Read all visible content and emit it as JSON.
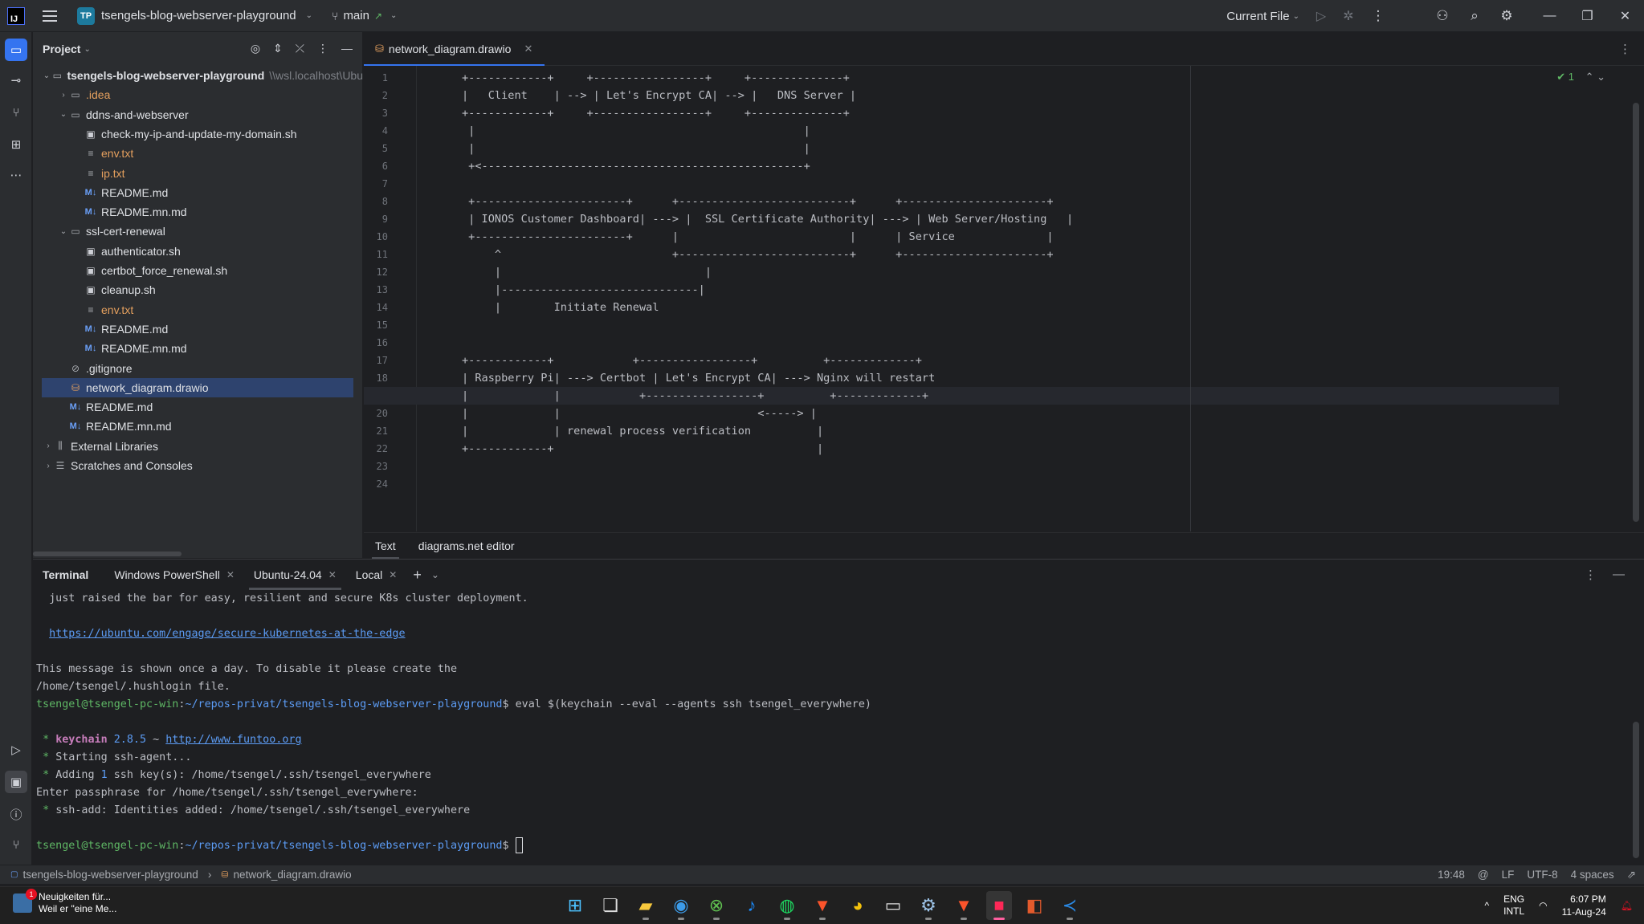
{
  "titlebar": {
    "badge": "TP",
    "project": "tsengels-blog-webserver-playground",
    "branch": "main",
    "branch_arrow": "↗",
    "run_config": "Current File"
  },
  "project_panel": {
    "title": "Project",
    "tree": [
      {
        "level": 0,
        "arrow": "⌄",
        "icon": "folder",
        "label": "tsengels-blog-webserver-playground",
        "suffix": "\\\\wsl.localhost\\Ubu",
        "bold": true
      },
      {
        "level": 1,
        "arrow": "›",
        "icon": "folder",
        "label": ".idea",
        "color": "orange"
      },
      {
        "level": 1,
        "arrow": "⌄",
        "icon": "folder",
        "label": "ddns-and-webserver"
      },
      {
        "level": 2,
        "arrow": "",
        "icon": "sh",
        "label": "check-my-ip-and-update-my-domain.sh"
      },
      {
        "level": 2,
        "arrow": "",
        "icon": "txt",
        "label": "env.txt",
        "color": "orange"
      },
      {
        "level": 2,
        "arrow": "",
        "icon": "txt",
        "label": "ip.txt",
        "color": "orange"
      },
      {
        "level": 2,
        "arrow": "",
        "icon": "md",
        "label": "README.md"
      },
      {
        "level": 2,
        "arrow": "",
        "icon": "md",
        "label": "README.mn.md"
      },
      {
        "level": 1,
        "arrow": "⌄",
        "icon": "folder",
        "label": "ssl-cert-renewal"
      },
      {
        "level": 2,
        "arrow": "",
        "icon": "sh",
        "label": "authenticator.sh"
      },
      {
        "level": 2,
        "arrow": "",
        "icon": "sh",
        "label": "certbot_force_renewal.sh"
      },
      {
        "level": 2,
        "arrow": "",
        "icon": "sh",
        "label": "cleanup.sh"
      },
      {
        "level": 2,
        "arrow": "",
        "icon": "txt",
        "label": "env.txt",
        "color": "orange"
      },
      {
        "level": 2,
        "arrow": "",
        "icon": "md",
        "label": "README.md"
      },
      {
        "level": 2,
        "arrow": "",
        "icon": "md",
        "label": "README.mn.md"
      },
      {
        "level": 1,
        "arrow": "",
        "icon": "ignore",
        "label": ".gitignore"
      },
      {
        "level": 1,
        "arrow": "",
        "icon": "drawio",
        "label": "network_diagram.drawio",
        "selected": true
      },
      {
        "level": 1,
        "arrow": "",
        "icon": "md",
        "label": "README.md"
      },
      {
        "level": 1,
        "arrow": "",
        "icon": "md",
        "label": "README.mn.md"
      },
      {
        "level": 0,
        "arrow": "›",
        "icon": "library",
        "label": "External Libraries"
      },
      {
        "level": 0,
        "arrow": "›",
        "icon": "scratch",
        "label": "Scratches and Consoles"
      }
    ]
  },
  "editor": {
    "tab": "network_diagram.drawio",
    "inspection_count": "1",
    "current_line": 19,
    "lines": [
      "+------------+     +-----------------+     +--------------+",
      "|   Client    | --> | Let's Encrypt CA| --> |   DNS Server |",
      "+------------+     +-----------------+     +--------------+",
      " |                                                  |",
      " |                                                  |",
      " +<-------------------------------------------------+",
      "",
      " +-----------------------+      +--------------------------+      +----------------------+",
      " | IONOS Customer Dashboard| ---> |  SSL Certificate Authority| ---> | Web Server/Hosting   |",
      " +-----------------------+      |                          |      | Service              |",
      "     ^                          +--------------------------+      +----------------------+",
      "     |                               |",
      "     |------------------------------|",
      "     |        Initiate Renewal",
      "",
      "",
      "+------------+            +-----------------+          +-------------+",
      "| Raspberry Pi| ---> Certbot | Let's Encrypt CA| ---> Nginx will restart",
      "|             |            +-----------------+          +-------------+",
      "|             |                              <-----> |",
      "|             | renewal process verification          |",
      "+------------+                                        |",
      "",
      ""
    ],
    "bottom_tabs": [
      "Text",
      "diagrams.net editor"
    ]
  },
  "terminal": {
    "title": "Terminal",
    "tabs": [
      {
        "label": "Windows PowerShell",
        "closable": true
      },
      {
        "label": "Ubuntu-24.04",
        "closable": true,
        "active": true
      },
      {
        "label": "Local",
        "closable": true
      }
    ],
    "line1": "just raised the bar for easy, resilient and secure K8s cluster deployment.",
    "link1": "https://ubuntu.com/engage/secure-kubernetes-at-the-edge",
    "line3": "This message is shown once a day. To disable it please create the",
    "line4": "/home/tsengel/.hushlogin file.",
    "prompt_user": "tsengel@tsengel-pc-win",
    "prompt_path": "~/repos-privat/tsengels-blog-webserver-playground",
    "prompt_sym": "$",
    "cmd1": " eval $(keychain --eval --agents ssh tsengel_everywhere)",
    "keychain_name": "keychain",
    "keychain_ver": "2.8.5",
    "keychain_sep": "~",
    "keychain_link": "http://www.funtoo.org",
    "starting": "Starting ssh-agent...",
    "adding_pre": "Adding",
    "adding_num": "1",
    "adding_post": "ssh key(s): /home/tsengel/.ssh/tsengel_everywhere",
    "passphrase": "Enter passphrase for /home/tsengel/.ssh/tsengel_everywhere:",
    "added": "ssh-add: Identities added: /home/tsengel/.ssh/tsengel_everywhere"
  },
  "statusbar": {
    "crumb_project": "tsengels-blog-webserver-playground",
    "crumb_file": "network_diagram.drawio",
    "position": "19:48",
    "line_sep": "LF",
    "encoding": "UTF-8",
    "indent": "4 spaces"
  },
  "taskbar": {
    "news_title": "Neuigkeiten für...",
    "news_sub": "Weil er \"eine Me...",
    "news_badge": "1",
    "lang1": "ENG",
    "lang2": "INTL",
    "time": "6:07 PM",
    "date": "11-Aug-24"
  }
}
